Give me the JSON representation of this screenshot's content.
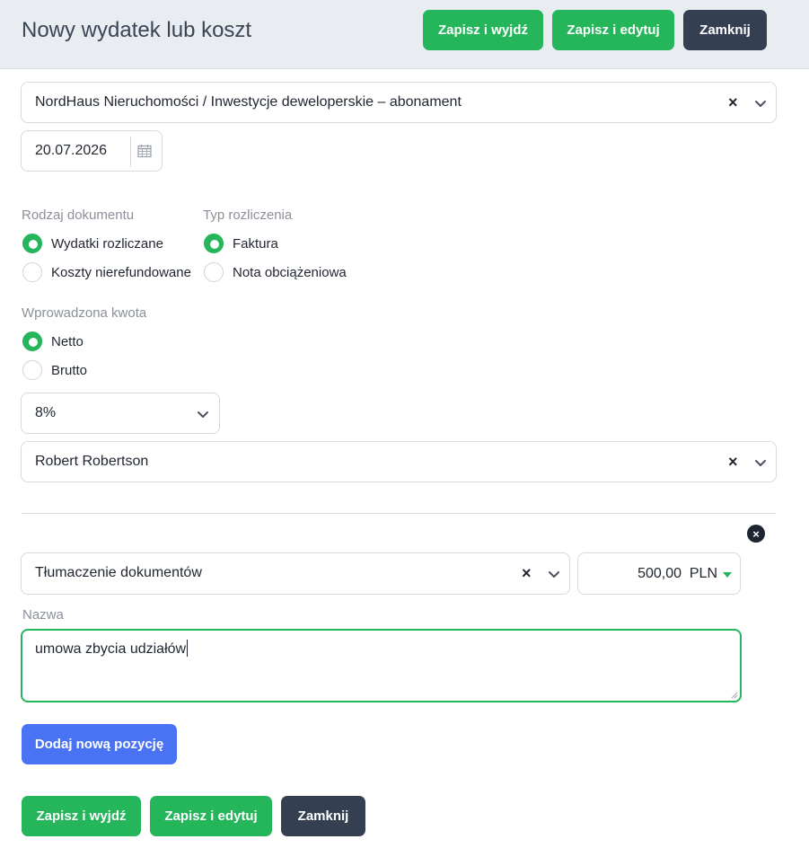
{
  "header": {
    "title": "Nowy wydatek lub koszt",
    "save_exit_label": "Zapisz i wyjdź",
    "save_edit_label": "Zapisz i edytuj",
    "close_label": "Zamknij"
  },
  "project_select": {
    "value": "NordHaus Nieruchomości / Inwestycje deweloperskie – abonament",
    "clear": "×"
  },
  "date_field": {
    "value": "20.07.2026",
    "icon": "calendar-icon"
  },
  "document_type": {
    "label": "Rodzaj dokumentu",
    "options": [
      {
        "label": "Wydatki rozliczane",
        "checked": true
      },
      {
        "label": "Koszty nierefundowane",
        "checked": false
      }
    ]
  },
  "settlement_type": {
    "label": "Typ rozliczenia",
    "options": [
      {
        "label": "Faktura",
        "checked": true
      },
      {
        "label": "Nota obciążeniowa",
        "checked": false
      }
    ]
  },
  "amount_type": {
    "label": "Wprowadzona kwota",
    "options": [
      {
        "label": "Netto",
        "checked": true
      },
      {
        "label": "Brutto",
        "checked": false
      }
    ]
  },
  "vat_select": {
    "value": "8%"
  },
  "person_select": {
    "value": "Robert Robertson",
    "clear": "×"
  },
  "position": {
    "remove": "×",
    "category": {
      "value": "Tłumaczenie dokumentów",
      "clear": "×"
    },
    "amount": "500,00",
    "currency": "PLN",
    "name_label": "Nazwa",
    "name_value": "umowa zbycia udziałów"
  },
  "footer": {
    "add_position_label": "Dodaj nową pozycję",
    "save_exit_label": "Zapisz i wyjdź",
    "save_edit_label": "Zapisz i edytuj",
    "close_label": "Zamknij"
  },
  "colors": {
    "accent_green": "#25b55b",
    "dark_button": "#343f52",
    "blue_button": "#4a72f4",
    "header_bg": "#e9ecf1"
  }
}
